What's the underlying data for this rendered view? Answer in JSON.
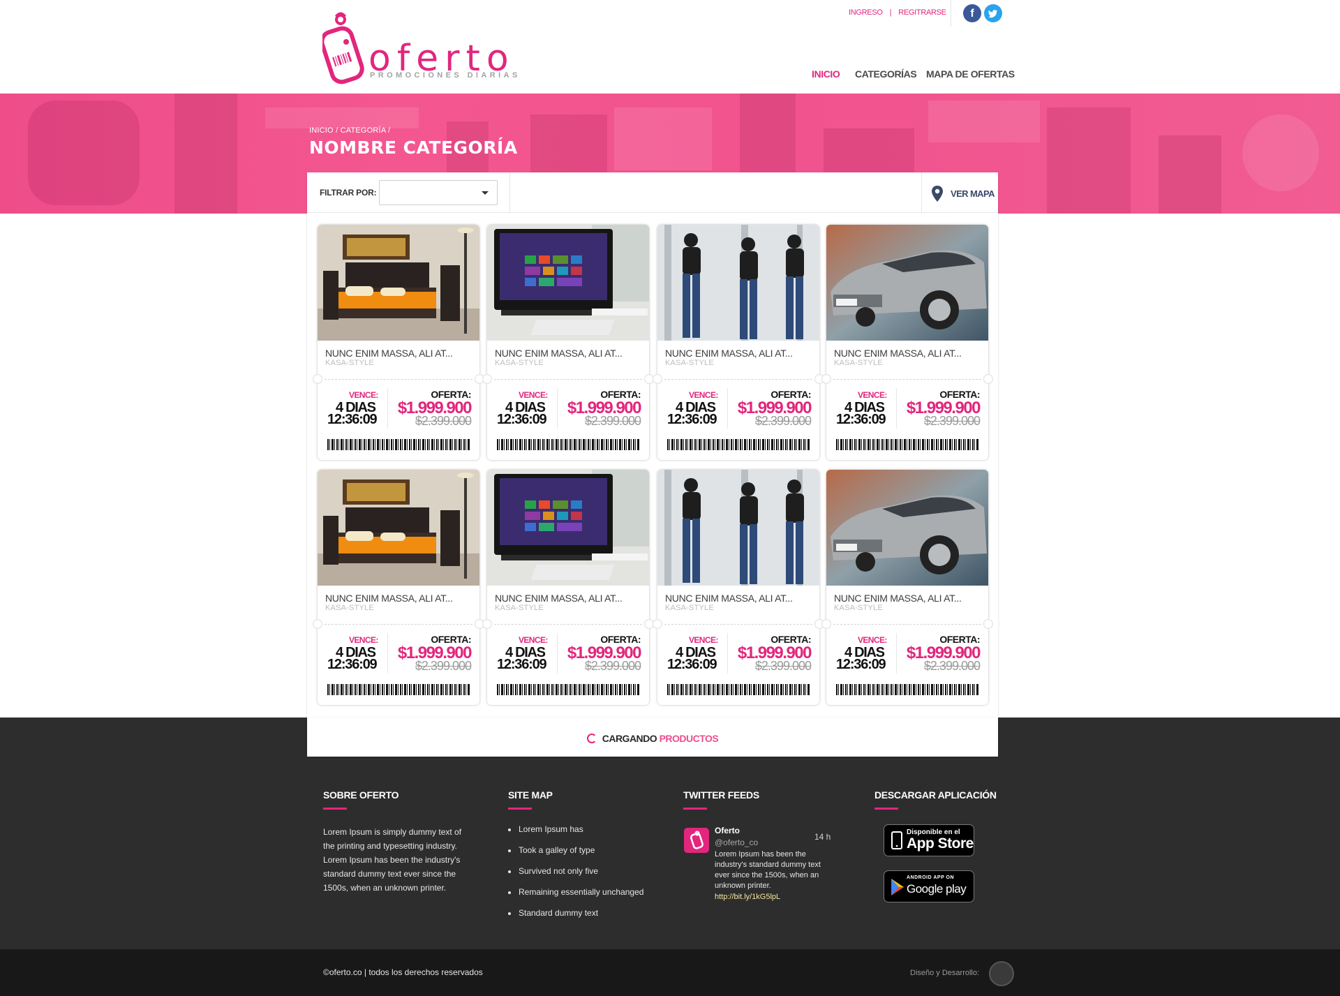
{
  "brand": {
    "name": "oferto",
    "tagline": "PROMOCIONES DIARIAS",
    "accent": "#e2267d"
  },
  "top_links": {
    "login": "INGRESO",
    "register": "REGITRARSE"
  },
  "nav": {
    "items": [
      "INICIO",
      "CATEGORÍAS",
      "MAPA DE OFERTAS"
    ],
    "active": "INICIO"
  },
  "hero": {
    "breadcrumb": "INICIO / CATEGORÍA /",
    "title": "NOMBRE CATEGORÍA"
  },
  "filter": {
    "label": "FILTRAR POR:",
    "selected": "",
    "map_label": "VER MAPA"
  },
  "products": [
    {
      "image": "bedroom",
      "name": "NUNC ENIM MASSA, ALI AT...",
      "store": "KASA-STYLE",
      "vence_label": "VENCE:",
      "days": "4 DIAS",
      "time": "12:36:09",
      "offer_label": "OFERTA:",
      "price": "$1.999.900",
      "old_price": "$2.399.000"
    },
    {
      "image": "computer",
      "name": "NUNC ENIM MASSA, ALI AT...",
      "store": "KASA-STYLE",
      "vence_label": "VENCE:",
      "days": "4 DIAS",
      "time": "12:36:09",
      "offer_label": "OFERTA:",
      "price": "$1.999.900",
      "old_price": "$2.399.000"
    },
    {
      "image": "models",
      "name": "NUNC ENIM MASSA, ALI AT...",
      "store": "KASA-STYLE",
      "vence_label": "VENCE:",
      "days": "4 DIAS",
      "time": "12:36:09",
      "offer_label": "OFERTA:",
      "price": "$1.999.900",
      "old_price": "$2.399.000"
    },
    {
      "image": "car",
      "name": "NUNC ENIM MASSA, ALI AT...",
      "store": "KASA-STYLE",
      "vence_label": "VENCE:",
      "days": "4 DIAS",
      "time": "12:36:09",
      "offer_label": "OFERTA:",
      "price": "$1.999.900",
      "old_price": "$2.399.000"
    },
    {
      "image": "bedroom",
      "name": "NUNC ENIM MASSA, ALI AT...",
      "store": "KASA-STYLE",
      "vence_label": "VENCE:",
      "days": "4 DIAS",
      "time": "12:36:09",
      "offer_label": "OFERTA:",
      "price": "$1.999.900",
      "old_price": "$2.399.000"
    },
    {
      "image": "computer",
      "name": "NUNC ENIM MASSA, ALI AT...",
      "store": "KASA-STYLE",
      "vence_label": "VENCE:",
      "days": "4 DIAS",
      "time": "12:36:09",
      "offer_label": "OFERTA:",
      "price": "$1.999.900",
      "old_price": "$2.399.000"
    },
    {
      "image": "models",
      "name": "NUNC ENIM MASSA, ALI AT...",
      "store": "KASA-STYLE",
      "vence_label": "VENCE:",
      "days": "4 DIAS",
      "time": "12:36:09",
      "offer_label": "OFERTA:",
      "price": "$1.999.900",
      "old_price": "$2.399.000"
    },
    {
      "image": "car",
      "name": "NUNC ENIM MASSA, ALI AT...",
      "store": "KASA-STYLE",
      "vence_label": "VENCE:",
      "days": "4 DIAS",
      "time": "12:36:09",
      "offer_label": "OFERTA:",
      "price": "$1.999.900",
      "old_price": "$2.399.000"
    }
  ],
  "loading": {
    "word1": "CARGANDO",
    "word2": "PRODUCTOS"
  },
  "footer": {
    "about": {
      "title": "SOBRE OFERTO",
      "text": "Lorem Ipsum is simply dummy text of the printing and typesetting industry. Lorem Ipsum has been the industry's standard dummy text ever since the 1500s, when an unknown printer."
    },
    "sitemap": {
      "title": "SITE MAP",
      "items": [
        "Lorem Ipsum has",
        "Took a galley of type",
        "Survived not only five",
        "Remaining essentially unchanged",
        "Standard dummy text"
      ]
    },
    "twitter": {
      "title": "TWITTER FEEDS",
      "name": "Oferto",
      "handle": "@oferto_co",
      "time": "14 h",
      "text": "Lorem Ipsum has been the industry's standard dummy text ever since the 1500s, when an unknown printer.",
      "link": "http://bit.ly/1kG5lpL"
    },
    "app": {
      "title": "DESCARGAR APLICACIÓN",
      "appstore_small": "Disponible en el",
      "appstore_big": "App Store",
      "play_small": "ANDROID APP ON",
      "play_big": "Google play"
    },
    "copyright": "©oferto.co | todos los derechos reservados",
    "credit": "Diseño y Desarrollo:"
  }
}
